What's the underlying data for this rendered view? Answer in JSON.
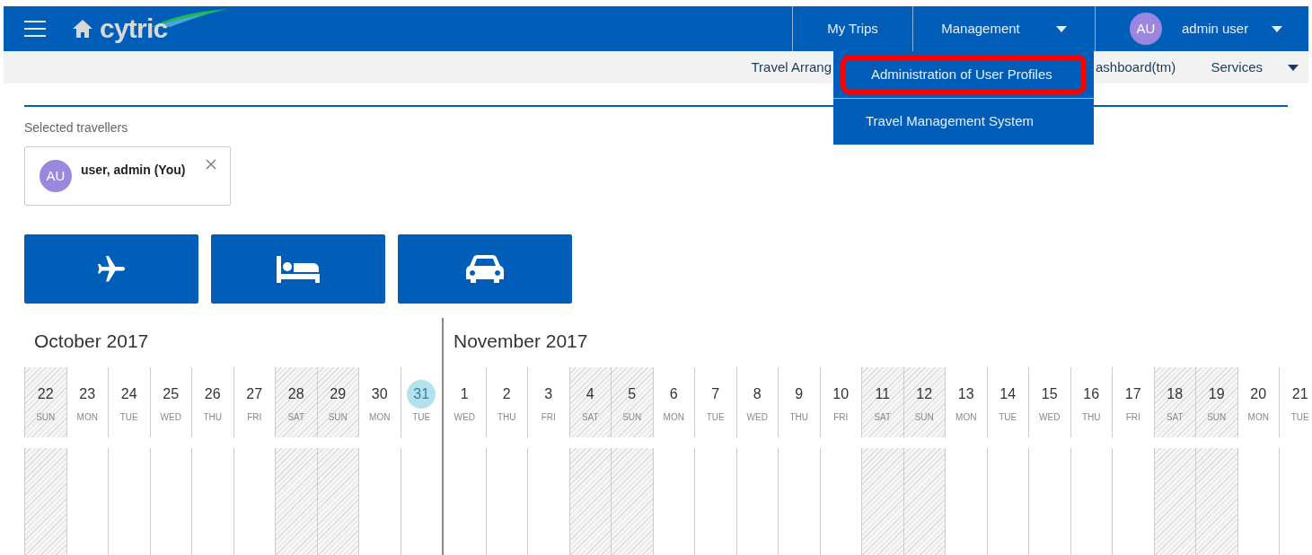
{
  "header": {
    "logo": "cytric",
    "nav": [
      {
        "label": "My Trips",
        "has_caret": false
      },
      {
        "label": "Management",
        "has_caret": true
      }
    ],
    "user": {
      "initials": "AU",
      "name": "admin user"
    }
  },
  "subnav": {
    "left_fragment": "Travel Arrang",
    "right_fragment": "ashboard(tm)",
    "last": "Services"
  },
  "dropdown": [
    {
      "label": "Administration of User Profiles",
      "highlighted": true
    },
    {
      "label": "Travel Management System",
      "highlighted": false
    }
  ],
  "travellers": {
    "label": "Selected travellers",
    "chips": [
      {
        "initials": "AU",
        "name": "user, admin (You)"
      }
    ]
  },
  "search_buttons": [
    {
      "kind": "flight"
    },
    {
      "kind": "hotel"
    },
    {
      "kind": "car"
    }
  ],
  "calendar": [
    {
      "title": "October 2017",
      "days": [
        {
          "num": "22",
          "dow": "SUN",
          "weekend": true,
          "today": false
        },
        {
          "num": "23",
          "dow": "MON",
          "weekend": false,
          "today": false
        },
        {
          "num": "24",
          "dow": "TUE",
          "weekend": false,
          "today": false
        },
        {
          "num": "25",
          "dow": "WED",
          "weekend": false,
          "today": false
        },
        {
          "num": "26",
          "dow": "THU",
          "weekend": false,
          "today": false
        },
        {
          "num": "27",
          "dow": "FRI",
          "weekend": false,
          "today": false
        },
        {
          "num": "28",
          "dow": "SAT",
          "weekend": true,
          "today": false
        },
        {
          "num": "29",
          "dow": "SUN",
          "weekend": true,
          "today": false
        },
        {
          "num": "30",
          "dow": "MON",
          "weekend": false,
          "today": false
        },
        {
          "num": "31",
          "dow": "TUE",
          "weekend": false,
          "today": true
        }
      ]
    },
    {
      "title": "November 2017",
      "days": [
        {
          "num": "1",
          "dow": "WED",
          "weekend": false,
          "today": false
        },
        {
          "num": "2",
          "dow": "THU",
          "weekend": false,
          "today": false
        },
        {
          "num": "3",
          "dow": "FRI",
          "weekend": false,
          "today": false
        },
        {
          "num": "4",
          "dow": "SAT",
          "weekend": true,
          "today": false
        },
        {
          "num": "5",
          "dow": "SUN",
          "weekend": true,
          "today": false
        },
        {
          "num": "6",
          "dow": "MON",
          "weekend": false,
          "today": false
        },
        {
          "num": "7",
          "dow": "TUE",
          "weekend": false,
          "today": false
        },
        {
          "num": "8",
          "dow": "WED",
          "weekend": false,
          "today": false
        },
        {
          "num": "9",
          "dow": "THU",
          "weekend": false,
          "today": false
        },
        {
          "num": "10",
          "dow": "FRI",
          "weekend": false,
          "today": false
        },
        {
          "num": "11",
          "dow": "SAT",
          "weekend": true,
          "today": false
        },
        {
          "num": "12",
          "dow": "SUN",
          "weekend": true,
          "today": false
        },
        {
          "num": "13",
          "dow": "MON",
          "weekend": false,
          "today": false
        },
        {
          "num": "14",
          "dow": "TUE",
          "weekend": false,
          "today": false
        },
        {
          "num": "15",
          "dow": "WED",
          "weekend": false,
          "today": false
        },
        {
          "num": "16",
          "dow": "THU",
          "weekend": false,
          "today": false
        },
        {
          "num": "17",
          "dow": "FRI",
          "weekend": false,
          "today": false
        },
        {
          "num": "18",
          "dow": "SAT",
          "weekend": true,
          "today": false
        },
        {
          "num": "19",
          "dow": "SUN",
          "weekend": true,
          "today": false
        },
        {
          "num": "20",
          "dow": "MON",
          "weekend": false,
          "today": false
        },
        {
          "num": "21",
          "dow": "TUE",
          "weekend": false,
          "today": false
        }
      ]
    }
  ]
}
